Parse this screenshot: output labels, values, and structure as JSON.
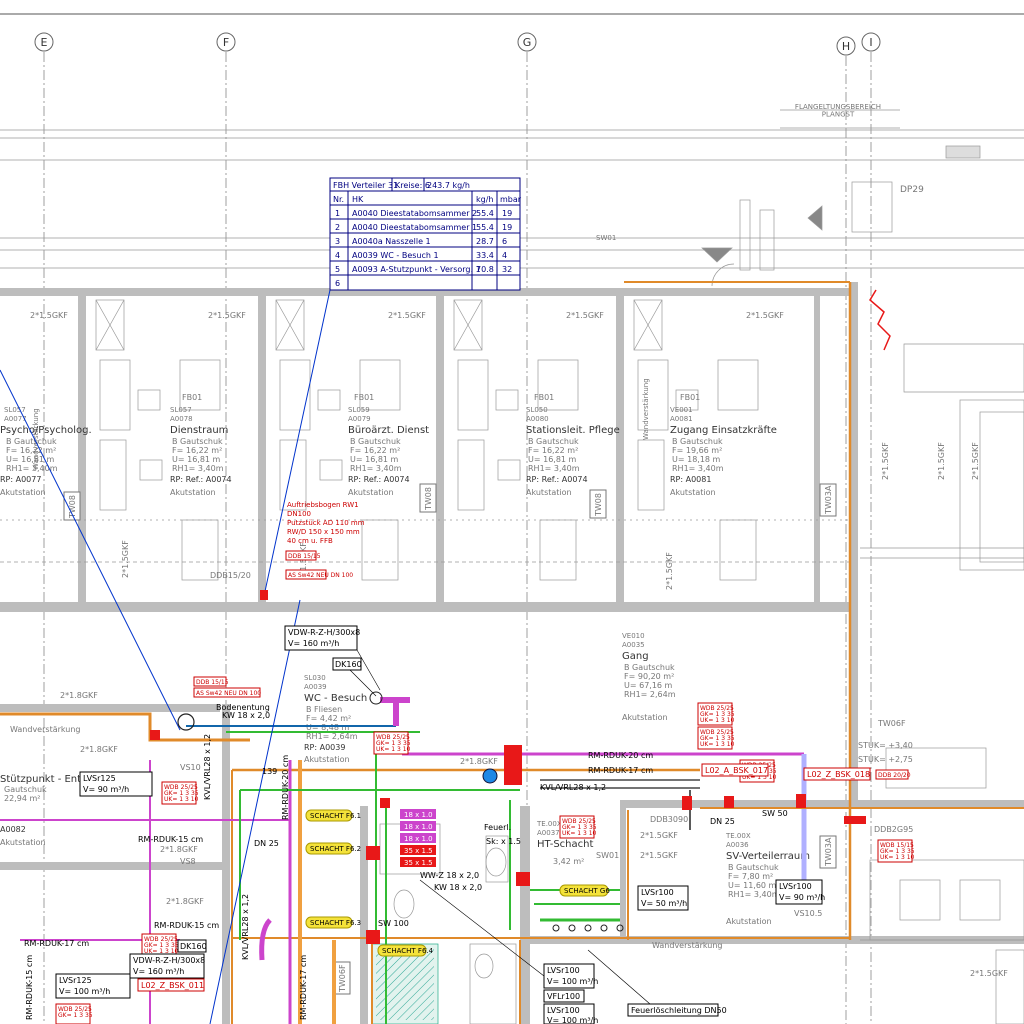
{
  "axes": [
    "E",
    "F",
    "G",
    "H",
    "I"
  ],
  "header_band": "FLANGELTUNGSBEREICH\nPLANGST",
  "fbh_table": {
    "title_cells": [
      "FBH Verteiler 31",
      "Kreise: 6",
      "243.7 kg/h"
    ],
    "headers": [
      "Nr.",
      "HK",
      "kg/h",
      "mbar"
    ],
    "rows": [
      [
        "1",
        "A0040  Dieestatabomsammer 2",
        "55.4",
        "19"
      ],
      [
        "2",
        "A0040  Dieestatabomsammer 1",
        "55.4",
        "19"
      ],
      [
        "3",
        "A0040a  Nasszelle 1",
        "28.7",
        "6"
      ],
      [
        "4",
        "A0039  WC - Besuch 1",
        "33.4",
        "4"
      ],
      [
        "5",
        "A0093  A-Stutzpunkt - Versorg. 1",
        "70.8",
        "32"
      ],
      [
        "6",
        "",
        "",
        ""
      ]
    ]
  },
  "rooms": [
    {
      "code": "SL057",
      "id": "A0077",
      "name": "Psycho/Psycholog.",
      "lines": [
        "B  Gautschuk",
        "F= 16,22 m²",
        "U= 16,81 m",
        "RH1= 3,40m"
      ],
      "rp": "RP: A0077",
      "note": "Akutstation"
    },
    {
      "code": "SL057",
      "id": "A0078",
      "name": "Dienstraum",
      "lines": [
        "B  Gautschuk",
        "F= 16,22 m²",
        "U= 16,81 m",
        "RH1= 3,40m"
      ],
      "rp": "RP: Ref.: A0074",
      "note": "Akutstation"
    },
    {
      "code": "SL059",
      "id": "A0079",
      "name": "Büroärzt. Dienst",
      "lines": [
        "B  Gautschuk",
        "F= 16,22 m²",
        "U= 16,81 m",
        "RH1= 3,40m"
      ],
      "rp": "RP: Ref.: A0074",
      "note": "Akutstation"
    },
    {
      "code": "SL050",
      "id": "A0080",
      "name": "Stationsleit. Pflege",
      "lines": [
        "B  Gautschuk",
        "F= 16,22 m²",
        "U= 16,81 m",
        "RH1= 3,40m"
      ],
      "rp": "RP: Ref.: A0074",
      "note": "Akutstation"
    },
    {
      "code": "VE001",
      "id": "A0081",
      "name": "Zugang Einsatzkräfte",
      "lines": [
        "B  Gautschuk",
        "F= 19,66 m²",
        "U= 18,18 m",
        "RH1= 3,40m"
      ],
      "rp": "RP: A0081",
      "note": "Akutstation"
    },
    {
      "code": "VE010",
      "id": "A0035",
      "name": "Gang",
      "lines": [
        "B  Gautschuk",
        "F= 90,20 m²",
        "U= 67,16 m",
        "RH1= 2,64m"
      ],
      "rp": "",
      "note": "Akutstation"
    },
    {
      "code": "SL030",
      "id": "A0039",
      "name": "WC - Besuch",
      "lines": [
        "B  Fliesen",
        "F= 4,42 m²",
        "U= 8,48 m",
        "RH1= 2,64m"
      ],
      "rp": "RP: A0039",
      "note": "Akutstation"
    },
    {
      "code": "TE.00X",
      "id": "A0036",
      "name": "SV-Verteilerraum",
      "lines": [
        "B  Gautschuk",
        "F= 7,80 m²",
        "U= 11,60 m",
        "RH1= 3,40m"
      ],
      "rp": "",
      "note": "Akutstation"
    },
    {
      "code": "",
      "id": "A0082",
      "name": "Stützpunkt - Entsorg.",
      "lines": [
        "Gautschuk",
        "22,94 m²"
      ],
      "rp": "",
      "note": "Akutstation"
    },
    {
      "code": "TE.00X",
      "id": "A0037",
      "name": "HT-Schacht",
      "lines": [
        "3,42 m²"
      ],
      "rp": "",
      "note": ""
    }
  ],
  "labels": {
    "fbo": "FB01",
    "gkf": "2*1.5GKF",
    "gkf2": "2*1.8GKF",
    "tw08": "TW08",
    "tw03a": "TW03A",
    "tw06f": "TW06F",
    "vs8": "VS8",
    "vs10": "VS10",
    "vs10_5": "VS10.5",
    "sw01": "SW01",
    "ddb": "DDB15/20",
    "ddb2": "DDB2G95",
    "ddb3": "DDB3090",
    "dp29": "DP29",
    "wand": "Wandverstärkung",
    "stuk1": "STUK= +3,40",
    "stuk2": "STUK= +2,75"
  },
  "red_note": [
    "Auftriebsbogen RW1",
    "DN100",
    "Putzstück AD 110 mm",
    "RW/D 150 x 150 mm",
    "40 cm u. FFB"
  ],
  "red_boxes": [
    "DDB 15/15",
    "AS Sw42 NEU DN 100",
    "WDB 25/25",
    "GK= 1 3 35",
    "UK= 1 3 10",
    "L02_Z_BSK_018",
    "L02_A_BSK_017",
    "L02_Z_BSK_011",
    "DDB 20/20",
    "WDB 15/15"
  ],
  "callouts": [
    {
      "id": "vdw1",
      "lines": [
        "VDW-R-Z-H/300x8",
        "V= 160 m³/h"
      ]
    },
    {
      "id": "dk160a",
      "lines": [
        "DK160"
      ]
    },
    {
      "id": "vdw2",
      "lines": [
        "VDW-R-Z-H/300x8",
        "V= 160 m³/h"
      ]
    },
    {
      "id": "dk160b",
      "lines": [
        "DK160"
      ]
    },
    {
      "id": "lvs125a",
      "lines": [
        "LVSr125",
        "V= 90 m³/h"
      ]
    },
    {
      "id": "lvs125b",
      "lines": [
        "LVSr125",
        "V= 100 m³/h"
      ]
    },
    {
      "id": "lvs100a",
      "lines": [
        "LVSr100",
        "V= 50 m³/h"
      ]
    },
    {
      "id": "lvs100b",
      "lines": [
        "LVSr100",
        "V= 90 m³/h"
      ]
    },
    {
      "id": "lvs100c",
      "lines": [
        "LVSr100",
        "V= 100 m³/h"
      ]
    },
    {
      "id": "vfl100",
      "lines": [
        "VFLr100"
      ]
    },
    {
      "id": "lvs100d",
      "lines": [
        "LVSr100",
        "V= 100 m³/h"
      ]
    },
    {
      "id": "feuer",
      "lines": [
        "Feuerlöschleitung DN50"
      ]
    }
  ],
  "pipe_labels": [
    "RM-RDUK-20 cm",
    "RM-RDUK-17 cm",
    "KVL/VRL28 x 1,2",
    "RM-RDUK-15 cm",
    "RM-RDUK-17 cm",
    "RM-RDUK-15 cm",
    "KW 18 x 2,0",
    "WW-Z 18 x 2,0",
    "KW 18 x 2,0",
    "Bodenentung",
    "DN 25",
    "SW 100",
    "SW 50",
    "139"
  ],
  "shaft_labels": [
    "SCHACHT F6.1",
    "SCHACHT F6.2",
    "SCHACHT F6.3",
    "SCHACHT G6",
    "SCHACHT F6.4"
  ],
  "pipe_tags": [
    "18 x 1.0",
    "18 x 1.0",
    "18 x 1.0",
    "35 x 1.5",
    "35 x 1.5"
  ],
  "misc": [
    "Feuerl.",
    "Sk: x 1.5",
    "DN 25"
  ]
}
